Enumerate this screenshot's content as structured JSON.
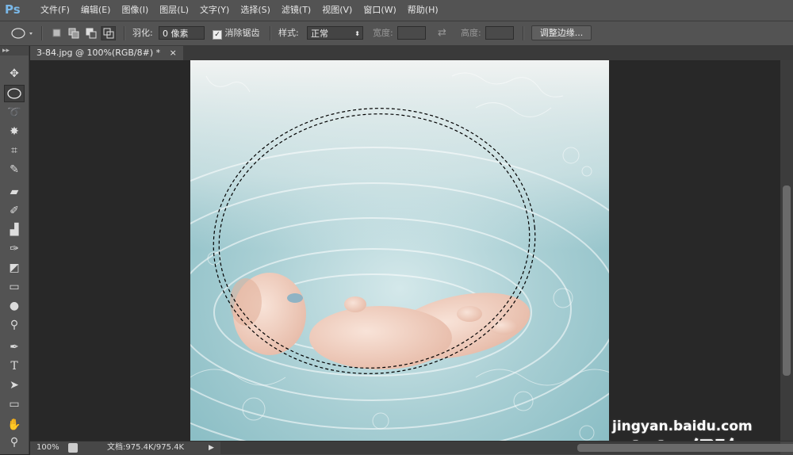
{
  "app": {
    "logo": "Ps"
  },
  "menu": [
    "文件(F)",
    "编辑(E)",
    "图像(I)",
    "图层(L)",
    "文字(Y)",
    "选择(S)",
    "滤镜(T)",
    "视图(V)",
    "窗口(W)",
    "帮助(H)"
  ],
  "options": {
    "feather_label": "羽化:",
    "feather_value": "0 像素",
    "antialias_label": "消除锯齿",
    "style_label": "样式:",
    "style_value": "正常",
    "width_label": "宽度:",
    "height_label": "高度:",
    "refine_edge": "调整边缘..."
  },
  "document": {
    "tab_title": "3-84.jpg @ 100%(RGB/8#) *",
    "close": "×"
  },
  "status": {
    "zoom": "100%",
    "doc_info": "文档:975.4K/975.4K"
  },
  "watermark": {
    "brand": "Bai  du 经验",
    "url": "jingyan.baidu.com"
  },
  "icons": {
    "move": "move-icon",
    "marquee": "elliptical-marquee-icon",
    "lasso": "lasso-icon",
    "wand": "magic-wand-icon",
    "crop": "crop-icon",
    "eyedropper": "eyedropper-icon",
    "heal": "healing-brush-icon",
    "brush": "brush-icon",
    "stamp": "clone-stamp-icon",
    "history": "history-brush-icon",
    "eraser": "eraser-icon",
    "gradient": "gradient-icon",
    "blur": "blur-icon",
    "dodge": "dodge-icon",
    "pen": "pen-icon",
    "type": "type-icon",
    "path": "path-selection-icon",
    "shape": "rectangle-shape-icon",
    "hand": "hand-icon",
    "zoom": "zoom-icon"
  }
}
